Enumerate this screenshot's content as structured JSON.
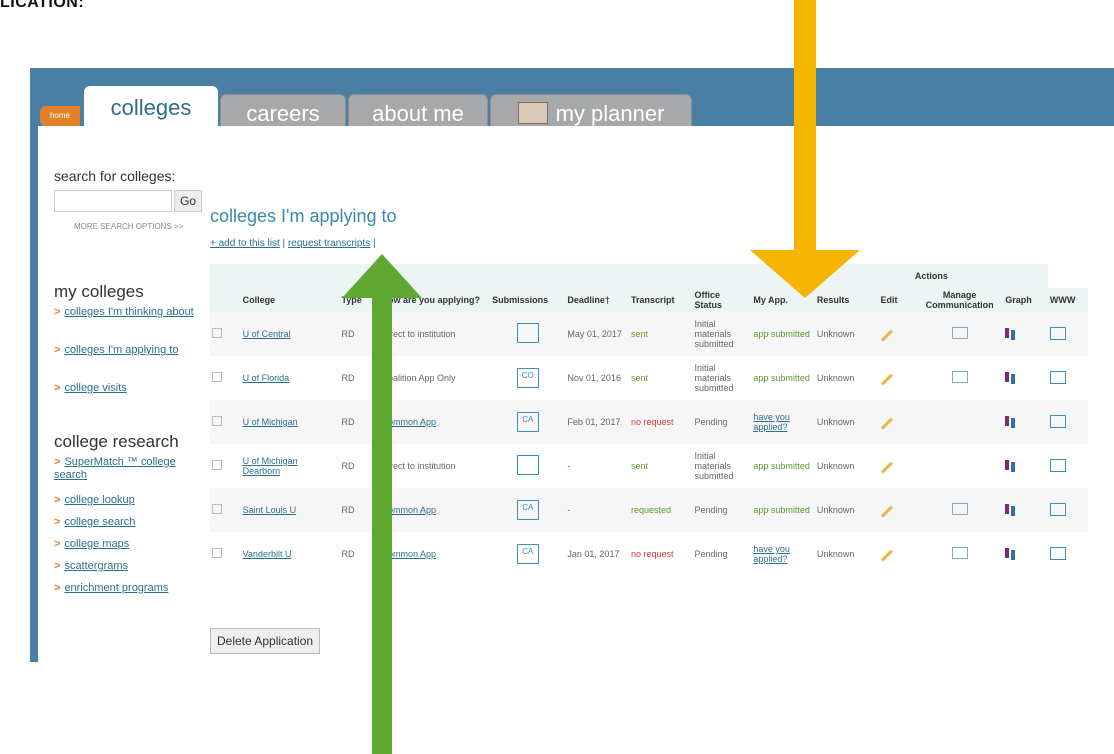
{
  "page_title_fragment": "LICATION:",
  "tabs": {
    "home": "home",
    "colleges": "colleges",
    "careers": "careers",
    "about": "about me",
    "planner": "my planner"
  },
  "search": {
    "label": "search for colleges:",
    "go": "Go",
    "more": "MORE SEARCH OPTIONS >>"
  },
  "sidebar": {
    "my_colleges_title": "my colleges",
    "my_colleges": [
      {
        "label": "colleges I'm thinking about"
      },
      {
        "label": "colleges I'm applying to"
      },
      {
        "label": "college visits"
      }
    ],
    "research_title": "college research",
    "research": [
      {
        "label": "SuperMatch ™ college search"
      },
      {
        "label": "college lookup"
      },
      {
        "label": "college search"
      },
      {
        "label": "college maps"
      },
      {
        "label": "scattergrams"
      },
      {
        "label": "enrichment programs"
      }
    ]
  },
  "main": {
    "title": "colleges I'm applying to",
    "add_link": "+ add to this list",
    "request_link": "request transcripts",
    "table": {
      "actions_label": "Actions",
      "headers": [
        "College",
        "Type",
        "How are you applying?",
        "Submissions",
        "Deadline†",
        "Transcript",
        "Office Status",
        "My App.",
        "Results",
        "Edit",
        "Manage Communication",
        "Graph",
        "WWW"
      ],
      "rows": [
        {
          "college": "U of Central",
          "type": "RD",
          "how": "Direct to institution",
          "sub": "",
          "deadline": "May 01, 2017",
          "transcript": "sent",
          "office": "Initial materials submitted",
          "myapp": "app submitted",
          "results": "Unknown"
        },
        {
          "college": "U of Florida",
          "type": "RD",
          "how": "Coalition App Only",
          "sub": "CO",
          "deadline": "Nov 01, 2016",
          "transcript": "sent",
          "office": "Initial materials submitted",
          "myapp": "app submitted",
          "results": "Unknown"
        },
        {
          "college": "U of Michigan",
          "type": "RD",
          "how": "Common App",
          "sub": "CA",
          "deadline": "Feb 01, 2017",
          "transcript": "no request",
          "office": "Pending",
          "myapp": "have you applied?",
          "results": "Unknown"
        },
        {
          "college": "U of Michigan Dearborn",
          "type": "RD",
          "how": "Direct to institution",
          "sub": "",
          "deadline": "-",
          "transcript": "sent",
          "office": "Initial materials submitted",
          "myapp": "app submitted",
          "results": "Unknown"
        },
        {
          "college": "Saint Louis U",
          "type": "RD",
          "how": "Common App",
          "sub": "CA",
          "deadline": "-",
          "transcript": "requested",
          "office": "Pending",
          "myapp": "app submitted",
          "results": "Unknown"
        },
        {
          "college": "Vanderbilt U",
          "type": "RD",
          "how": "Common App",
          "sub": "CA",
          "deadline": "Jan 01, 2017",
          "transcript": "no request",
          "office": "Pending",
          "myapp": "have you applied?",
          "results": "Unknown"
        }
      ]
    },
    "delete_button": "Delete Application"
  },
  "colors": {
    "arrow_green": "#5fa832",
    "arrow_orange": "#f5b400",
    "header_blue": "#4a7fa5",
    "accent_orange": "#e48128"
  }
}
